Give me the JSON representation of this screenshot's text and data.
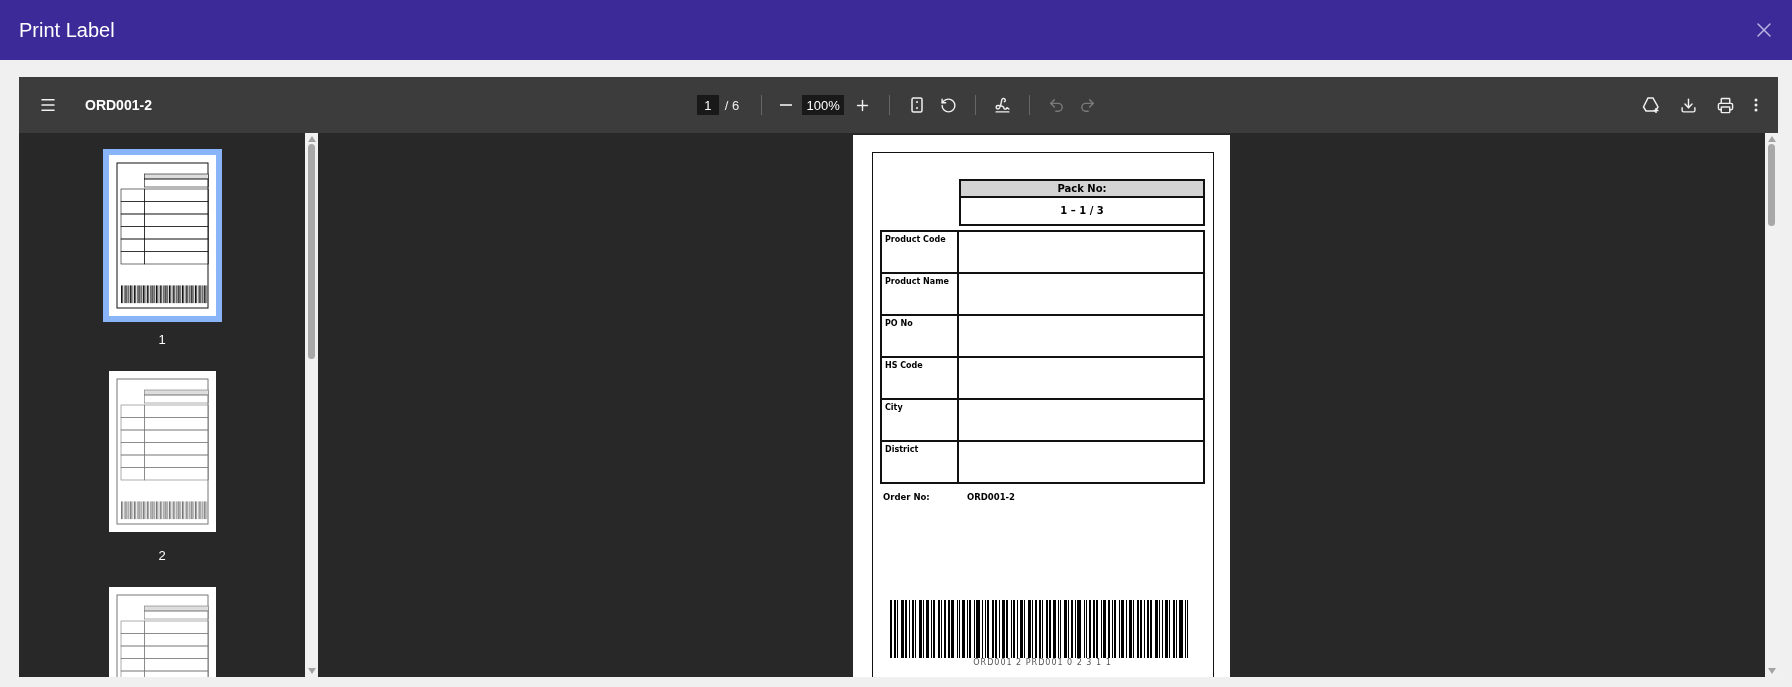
{
  "dialog": {
    "title": "Print Label"
  },
  "toolbar": {
    "document_title": "ORD001-2",
    "page_input": "1",
    "page_total": "/ 6",
    "zoom": "100%",
    "tools": [
      {
        "kind": "zoom-out",
        "disabled": false
      },
      {
        "kind": "zoom-in",
        "disabled": false
      },
      {
        "kind": "fit",
        "disabled": false
      },
      {
        "kind": "rotate",
        "disabled": false
      },
      {
        "kind": "draw",
        "disabled": false
      },
      {
        "kind": "undo",
        "disabled": true
      },
      {
        "kind": "redo",
        "disabled": true
      }
    ],
    "actions": [
      {
        "kind": "drive"
      },
      {
        "kind": "download"
      },
      {
        "kind": "print"
      },
      {
        "kind": "more"
      }
    ]
  },
  "thumbnails": [
    {
      "label": "1",
      "selected": true
    },
    {
      "label": "2",
      "selected": false
    },
    {
      "selected": false
    }
  ],
  "label_page": {
    "pack_header": "Pack No:",
    "pack_value": "1 – 1 / 3",
    "fields": [
      {
        "label": "Product Code"
      },
      {
        "label": "Product Name"
      },
      {
        "label": "PO No"
      },
      {
        "label": "HS Code"
      },
      {
        "label": "City"
      },
      {
        "label": "District"
      }
    ],
    "order_label": "Order No:",
    "order_value": "ORD001-2",
    "barcode_text": "ORD001 2 PRD001 0 2 3 1 1"
  }
}
